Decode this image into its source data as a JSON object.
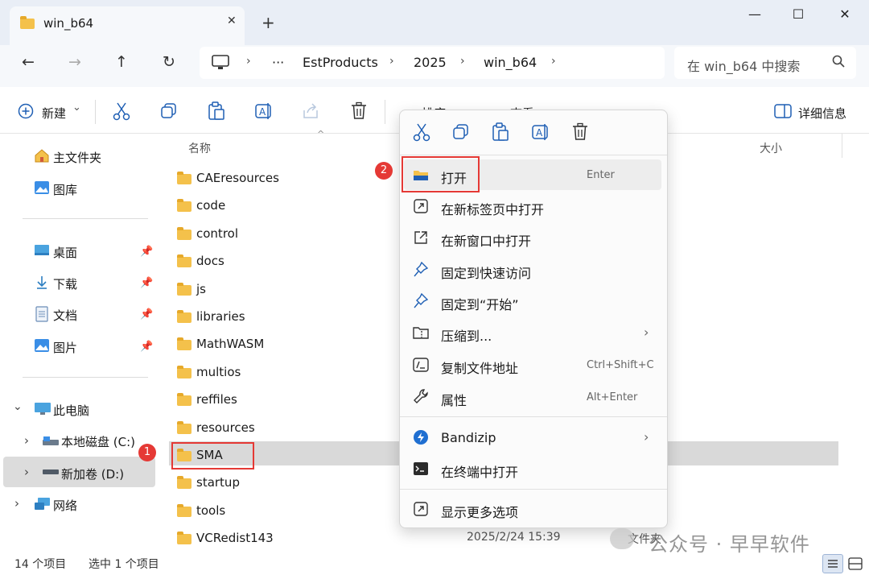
{
  "window": {
    "tab_title": "win_b64",
    "tab_close": "✕",
    "tab_new": "+",
    "minimize": "—",
    "maximize": "☐",
    "close": "✕"
  },
  "nav": {
    "back": "←",
    "forward": "→",
    "up": "↑",
    "refresh": "↻"
  },
  "address": {
    "more": "···",
    "crumbs": [
      "EstProducts",
      "2025",
      "win_b64"
    ],
    "chevron": "›"
  },
  "search": {
    "placeholder": "在 win_b64 中搜索"
  },
  "toolbar": {
    "new_label": "新建",
    "new_caret": "⌄",
    "details_label": "详细信息",
    "sort_partial": "排序",
    "view_partial": "查看"
  },
  "sidebar": {
    "home": "主文件夹",
    "gallery": "图库",
    "quick": [
      {
        "label": "桌面",
        "pin": "📌"
      },
      {
        "label": "下载",
        "pin": "📌"
      },
      {
        "label": "文档",
        "pin": "📌"
      },
      {
        "label": "图片",
        "pin": "📌"
      }
    ],
    "this_pc": "此电脑",
    "drive_c": "本地磁盘 (C:)",
    "drive_d": "新加卷 (D:)",
    "network": "网络",
    "expand": "›",
    "collapse": "⌄"
  },
  "filelist": {
    "col_name": "名称",
    "col_size": "大小",
    "sort_arrow": "^",
    "items": [
      "CAEresources",
      "code",
      "control",
      "docs",
      "js",
      "libraries",
      "MathWASM",
      "multios",
      "reffiles",
      "resources",
      "SMA",
      "startup",
      "tools",
      "VCRedist143"
    ],
    "last_date": "2025/2/24 15:39",
    "last_type": "文件夹"
  },
  "context_menu": {
    "items": [
      {
        "label": "打开",
        "shortcut": "Enter"
      },
      {
        "label": "在新标签页中打开",
        "shortcut": ""
      },
      {
        "label": "在新窗口中打开",
        "shortcut": ""
      },
      {
        "label": "固定到快速访问",
        "shortcut": ""
      },
      {
        "label": "固定到“开始”",
        "shortcut": ""
      },
      {
        "label": "压缩到...",
        "shortcut": "›"
      },
      {
        "label": "复制文件地址",
        "shortcut": "Ctrl+Shift+C"
      },
      {
        "label": "属性",
        "shortcut": "Alt+Enter"
      },
      {
        "label": "Bandizip",
        "shortcut": "›"
      },
      {
        "label": "在终端中打开",
        "shortcut": ""
      },
      {
        "label": "显示更多选项",
        "shortcut": ""
      }
    ]
  },
  "annotations": {
    "badge1": "1",
    "badge2": "2"
  },
  "status": {
    "count": "14 个项目",
    "selected": "选中 1 个项目"
  },
  "watermark": "公众号 · 早早软件",
  "colors": {
    "accent": "#1f5fb4",
    "highlight_red": "#e53935",
    "folder_yellow": "#f4c14b",
    "selected_row": "#d9d9d9"
  }
}
